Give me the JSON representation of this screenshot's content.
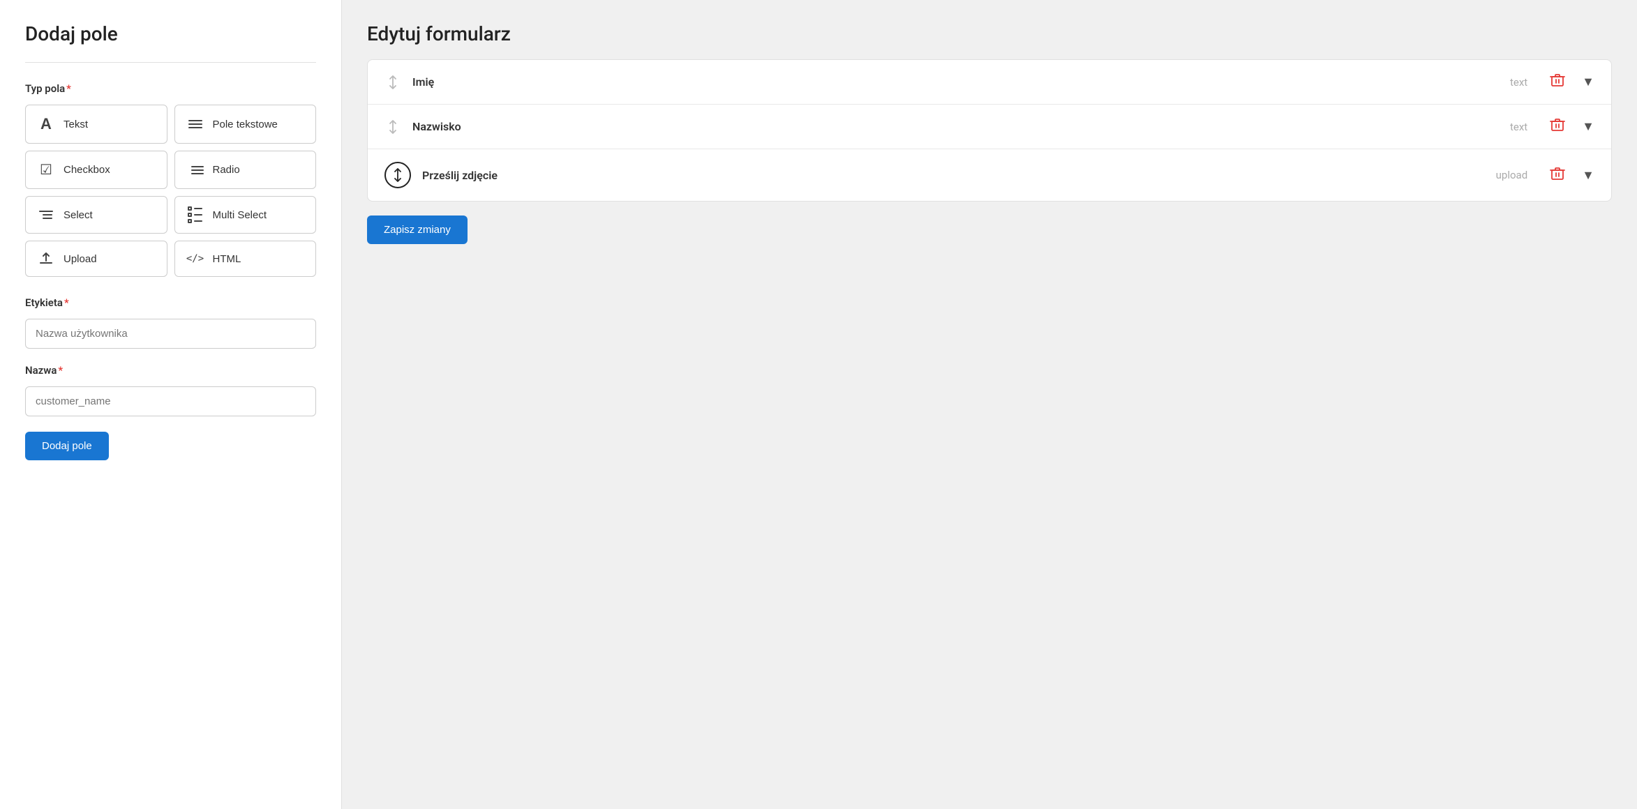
{
  "left_panel": {
    "title": "Dodaj pole",
    "field_type_label": "Typ pola",
    "required_marker": "*",
    "field_types": [
      {
        "id": "tekst",
        "label": "Tekst",
        "icon": "A"
      },
      {
        "id": "pole-tekstowe",
        "label": "Pole tekstowe",
        "icon": "≡"
      },
      {
        "id": "checkbox",
        "label": "Checkbox",
        "icon": "☑"
      },
      {
        "id": "radio",
        "label": "Radio",
        "icon": "☰"
      },
      {
        "id": "select",
        "label": "Select",
        "icon": "☰"
      },
      {
        "id": "multi-select",
        "label": "Multi Select",
        "icon": "☰"
      },
      {
        "id": "upload",
        "label": "Upload",
        "icon": "⬆"
      },
      {
        "id": "html",
        "label": "HTML",
        "icon": "</>"
      }
    ],
    "etykieta_label": "Etykieta",
    "etykieta_placeholder": "Nazwa użytkownika",
    "nazwa_label": "Nazwa",
    "nazwa_placeholder": "customer_name",
    "submit_button": "Dodaj pole"
  },
  "right_panel": {
    "title": "Edytuj formularz",
    "form_rows": [
      {
        "id": "imie",
        "label": "Imię",
        "type": "text"
      },
      {
        "id": "nazwisko",
        "label": "Nazwisko",
        "type": "text"
      },
      {
        "id": "przeslij",
        "label": "Prześlij zdjęcie",
        "type": "upload"
      }
    ],
    "save_button": "Zapisz zmiany"
  },
  "icons": {
    "tekst": "A",
    "pole_tekstowe": "≡",
    "checkbox": "☑",
    "radio": "☰",
    "select": "☰",
    "multi_select": "☰",
    "upload": "⬆",
    "html": "</>",
    "sort": "↕",
    "delete": "🗑",
    "chevron": "▼",
    "sort_arrows": "↓↑"
  }
}
